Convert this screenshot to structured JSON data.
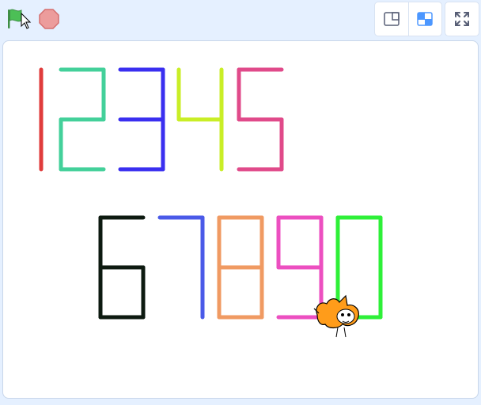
{
  "toolbar": {
    "green_flag": {
      "icon": "green-flag-icon",
      "color": "#4cbf56"
    },
    "stop": {
      "icon": "stop-sign-icon",
      "color": "#ec9c9c"
    },
    "layout_small": {
      "icon": "small-stage-icon"
    },
    "layout_normal": {
      "icon": "normal-stage-icon",
      "accent": "#4c97ff"
    },
    "fullscreen": {
      "icon": "fullscreen-icon"
    }
  },
  "stage": {
    "background": "#ffffff",
    "digits": [
      {
        "digit": "1",
        "color": "#e03c3c"
      },
      {
        "digit": "2",
        "color": "#43d09a"
      },
      {
        "digit": "3",
        "color": "#3a2ff0"
      },
      {
        "digit": "4",
        "color": "#c9ee26"
      },
      {
        "digit": "5",
        "color": "#e04a8a"
      },
      {
        "digit": "6",
        "color": "#0d1a10"
      },
      {
        "digit": "7",
        "color": "#4a5ae8"
      },
      {
        "digit": "8",
        "color": "#f09a62"
      },
      {
        "digit": "9",
        "color": "#ec4fc0"
      },
      {
        "digit": "0",
        "color": "#2ef038"
      }
    ],
    "sprite": {
      "name": "cat-sprite",
      "color": "#ff9c1a"
    }
  }
}
